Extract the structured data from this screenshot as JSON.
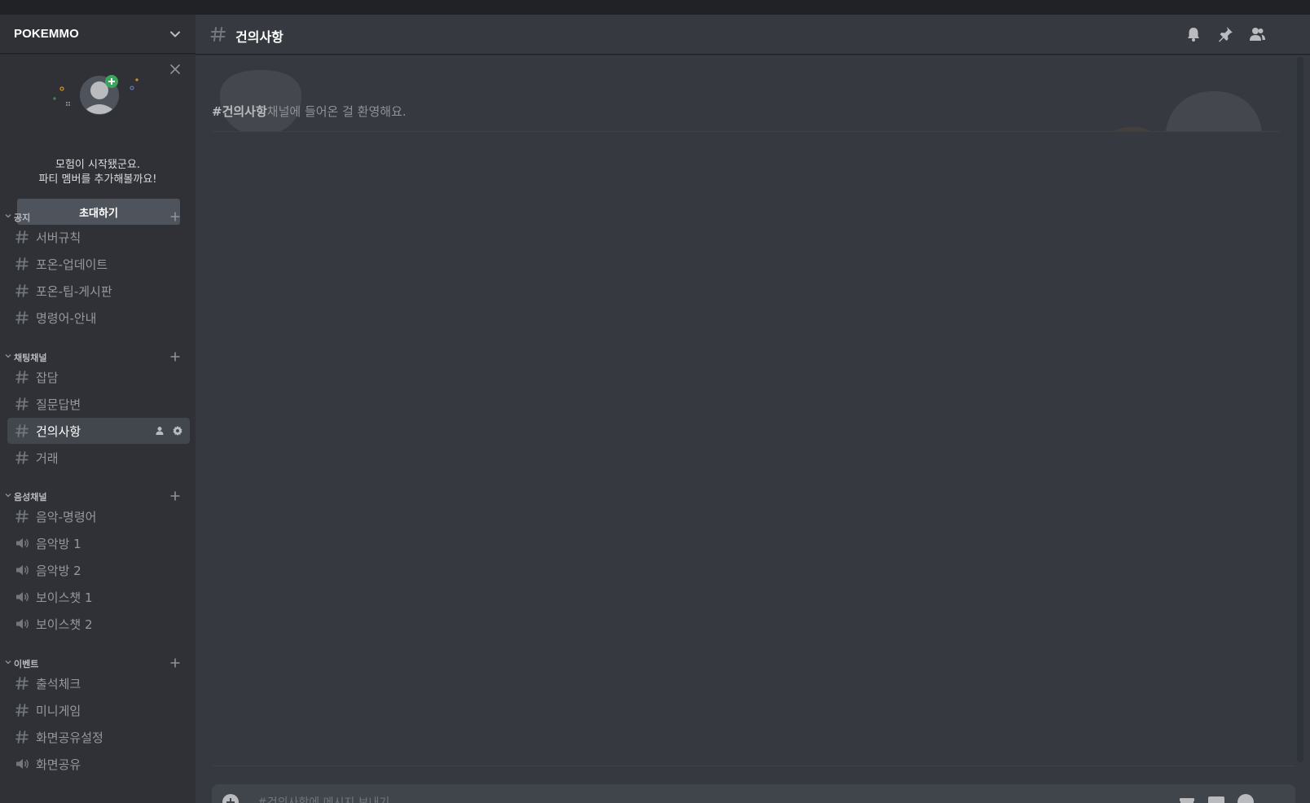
{
  "server": {
    "name": "POKEMMO"
  },
  "invite": {
    "line1": "모험이 시작됐군요.",
    "line2": "파티 멤버를 추가해볼까요!",
    "button": "초대하기"
  },
  "categories": [
    {
      "label": "공지",
      "channels": [
        {
          "label": "서버규칙",
          "type": "text"
        },
        {
          "label": "포온-업데이트",
          "type": "text"
        },
        {
          "label": "포온-팁-게시판",
          "type": "text"
        },
        {
          "label": "명령어-안내",
          "type": "text"
        }
      ]
    },
    {
      "label": "채팅채널",
      "channels": [
        {
          "label": "잡담",
          "type": "text"
        },
        {
          "label": "질문답변",
          "type": "text"
        },
        {
          "label": "건의사항",
          "type": "text",
          "active": true
        },
        {
          "label": "거래",
          "type": "text"
        }
      ]
    },
    {
      "label": "음성채널",
      "channels": [
        {
          "label": "음악-명령어",
          "type": "text"
        },
        {
          "label": "음악방 1",
          "type": "voice"
        },
        {
          "label": "음악방 2",
          "type": "voice"
        },
        {
          "label": "보이스챗 1",
          "type": "voice"
        },
        {
          "label": "보이스챗 2",
          "type": "voice"
        }
      ]
    },
    {
      "label": "이벤트",
      "channels": [
        {
          "label": "출석체크",
          "type": "text"
        },
        {
          "label": "미니게임",
          "type": "text"
        },
        {
          "label": "화면공유설정",
          "type": "text"
        },
        {
          "label": "화면공유",
          "type": "voice"
        }
      ]
    }
  ],
  "channel": {
    "title": "건의사항",
    "welcome_channel": "#건의사항",
    "welcome_rest": "채널에 들어온 걸 환영해요.",
    "composer_placeholder": "#건의사항에 메시지 보내기"
  },
  "colors": {
    "background": "#36393f",
    "sidebar": "#2f3136",
    "titlebar": "#202225",
    "active_channel": "#42464d",
    "invite_button": "#4f545c",
    "accent_green": "#3ba55d"
  },
  "icons": {
    "header": [
      "bell-icon",
      "pin-icon",
      "members-icon"
    ],
    "text_channel": "hash-icon",
    "voice_channel": "speaker-icon",
    "composer": [
      "plus-icon",
      "gift-icon",
      "gif-icon",
      "emoji-icon"
    ]
  }
}
